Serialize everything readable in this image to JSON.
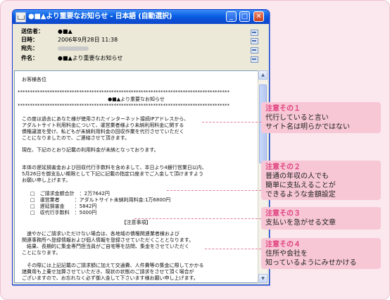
{
  "window": {
    "title": "●■▲より重要なお知らせ - 日本語 (自動選択)"
  },
  "header": {
    "from_label": "送信者：",
    "from_value": "●■▲",
    "date_label": "日時：",
    "date_value": "2006年9月28日 11:38",
    "to_label": "宛先：",
    "subject_label": "件名：",
    "subject_value": "●■▲より重要なお知らせ"
  },
  "body": {
    "greeting": "お客様各位",
    "stars": "**************************************************************************************",
    "banner_title": "●■▲より重要なお知らせ",
    "p1": [
      "この度は過去にあなた様が使用されたインターネット接続IPアドレスから、",
      "アダルトサイト利用料金について、運営業者様より未納利用料金に関する",
      "債権譲渡を受け、私どもが未納利用料金の回収作業を代行させていただく",
      "ことになりましたので、ご連絡させて頂きます。"
    ],
    "p2": "現在、下記のとおり記載の利用料金が未納となっております。",
    "p3": [
      "本体の遅延損害金および回収代行手数料を含めまして、本日より4銀行営業日以内、",
      "5月26日を御支払い期限として下記に記載の指定口座までご入金して頂けますよう",
      "お願い申し上げます。"
    ],
    "bill": [
      "□　ご請求金額合計　：2万7642円",
      "□　運営業者　　　：アダルトサイト未納利用料金:1万6800円",
      "□　遅延損害金　　：5842円",
      "□　収代行手数料　：5000円"
    ],
    "notes_title": "【注意事項】",
    "p4": [
      "　速やかにご請求いただけない場合は、各地域の債権関連業者様および",
      "関連事務所へ登録情報および個人情報を登録させていただくこととなります。",
      "　結果、長期的に集金専門担当員がご自宅等を訪問、集金をさせていただく",
      "ことになります。"
    ],
    "p5": [
      "　その際には上記記載のご請求額に加えて交通費、人件費等の集金に際してかかる",
      "諸費用も上乗せ加算させていただき、現状の状態のご請求をさせて頂く場合が",
      "ございますので、お忘れなく必ず御入金して下さいます様お願い申し上げます。"
    ]
  },
  "callouts": [
    {
      "title": "注意その１",
      "lines": [
        "代行していると言い",
        "サイト名は明らかではない"
      ]
    },
    {
      "title": "注意その２",
      "lines": [
        "普通の年収の人でも",
        "簡単に支払えることが",
        "できるような金額設定"
      ]
    },
    {
      "title": "注意その３",
      "lines": [
        "支払いを急がせる文章"
      ]
    },
    {
      "title": "注意その４",
      "lines": [
        "住所や会社を",
        "知っているようにみせかける"
      ]
    }
  ],
  "colors": {
    "background": "#fbe7ee",
    "callout_bg": "#f7c7d6",
    "callout_title": "#e0437f",
    "titlebar": "#0b4fd6"
  }
}
